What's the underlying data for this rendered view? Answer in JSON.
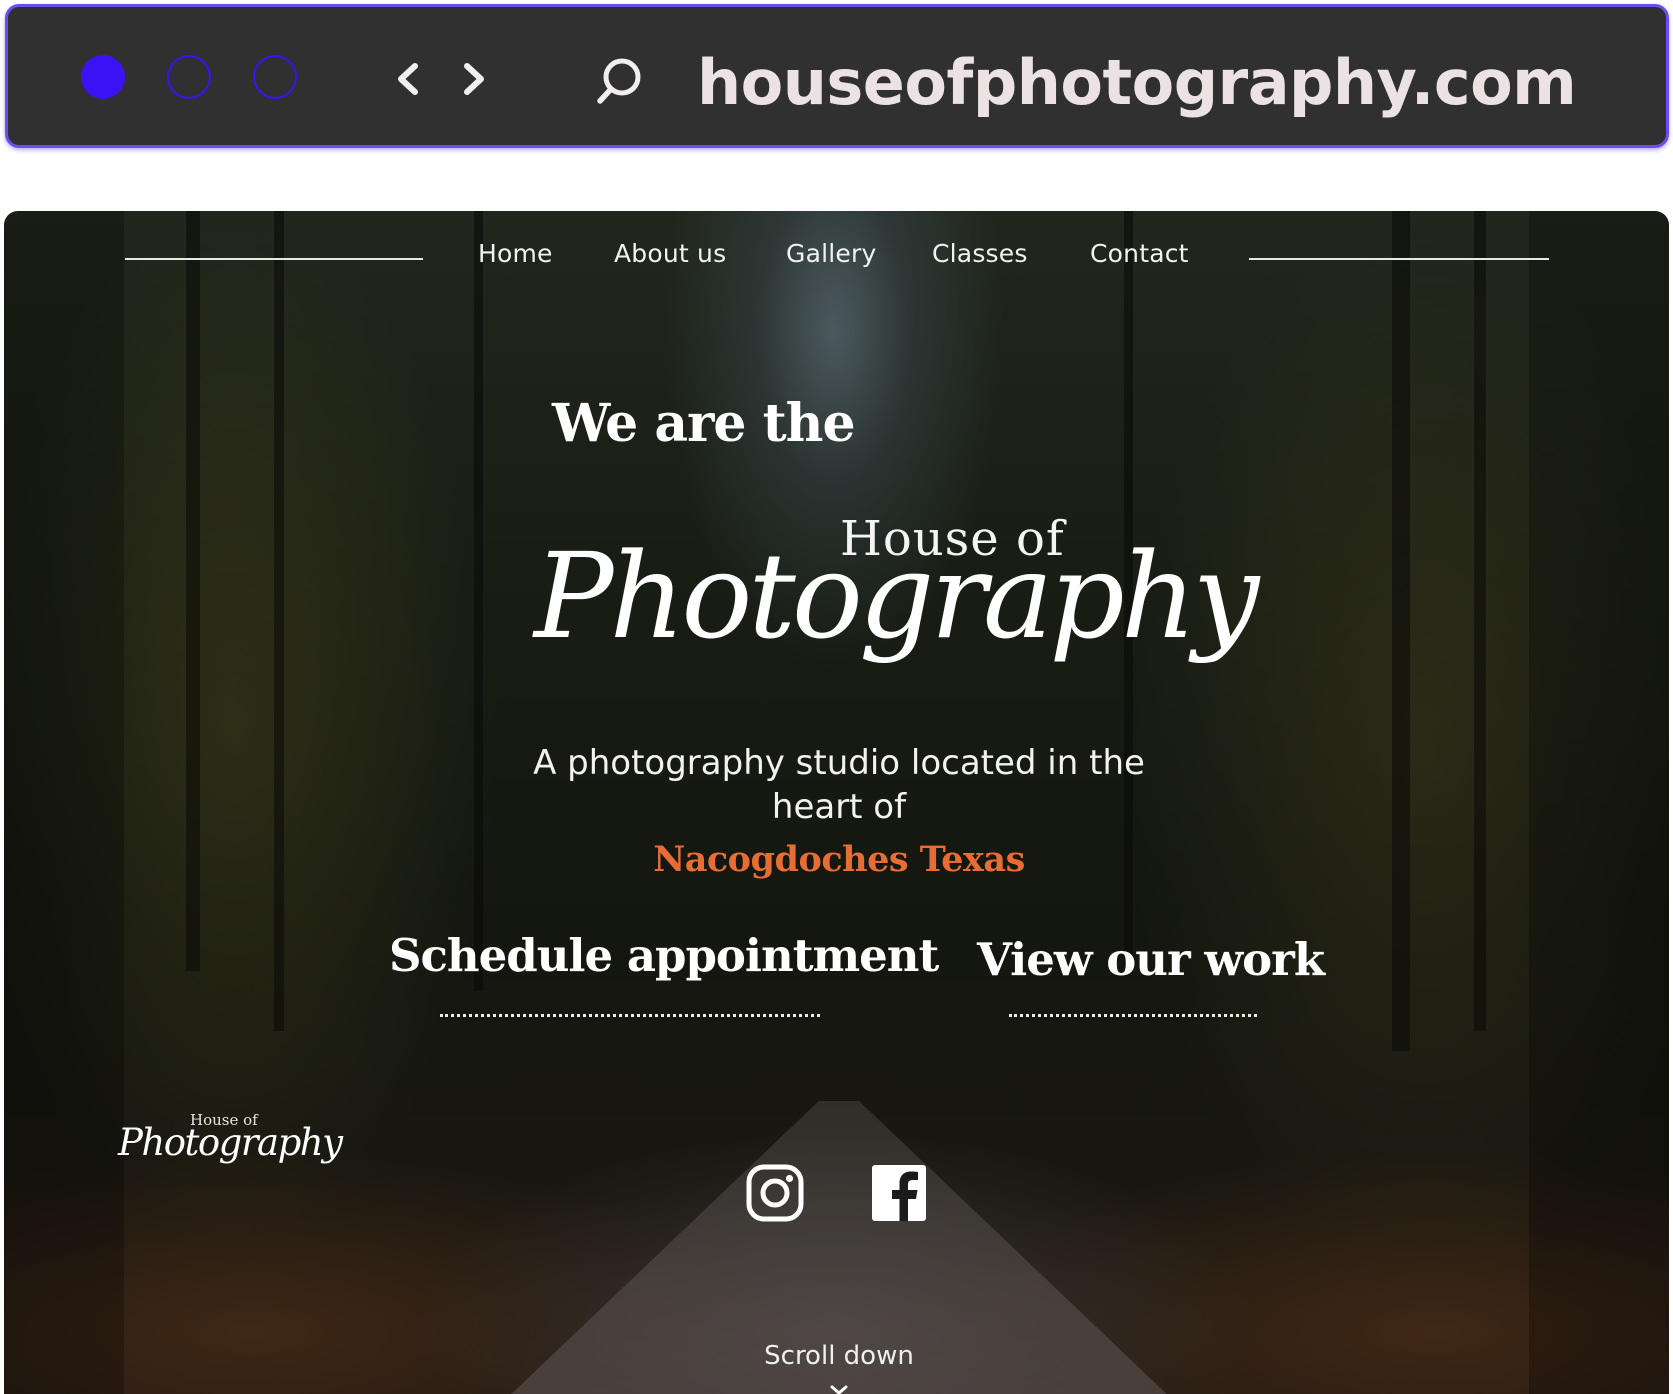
{
  "browser": {
    "url": "houseofphotography.com",
    "accent_color": "#3a12f4",
    "frame_color": "#303030",
    "icons": [
      "window-dot-filled",
      "window-dot-outline",
      "window-dot-outline",
      "back-chevron-icon",
      "forward-chevron-icon",
      "search-icon"
    ]
  },
  "site": {
    "nav": {
      "items": [
        {
          "label": "Home"
        },
        {
          "label": "About us"
        },
        {
          "label": "Gallery"
        },
        {
          "label": "Classes"
        },
        {
          "label": "Contact"
        }
      ]
    },
    "hero": {
      "headline": "We are the",
      "logo": {
        "small": "House of",
        "script": "Photography"
      },
      "tagline": "A photography studio located in the heart of",
      "location": "Nacogdoches Texas",
      "location_color": "#e86d35",
      "cta_primary": "Schedule appointment",
      "cta_secondary": "View our work"
    },
    "footer_logo": {
      "small": "House of",
      "script": "Photography"
    },
    "social": [
      {
        "name": "instagram-icon"
      },
      {
        "name": "facebook-icon"
      }
    ],
    "scroll_label": "Scroll down"
  }
}
